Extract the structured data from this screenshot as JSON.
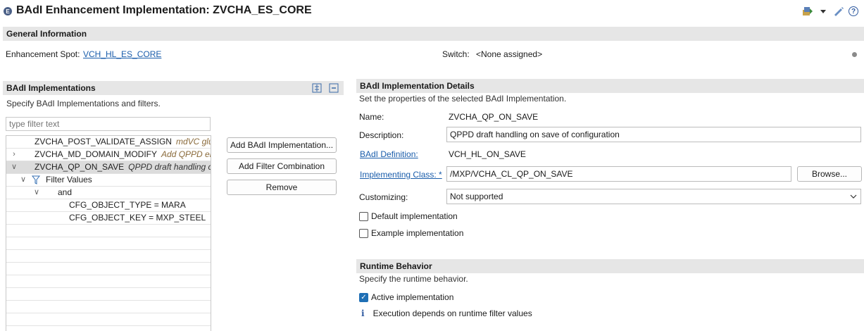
{
  "header": {
    "title": "BAdI Enhancement Implementation: ZVCHA_ES_CORE",
    "title_icon": "E"
  },
  "general": {
    "section_title": "General Information",
    "enh_spot_label": "Enhancement Spot:",
    "enh_spot_value": "VCH_HL_ES_CORE",
    "switch_label": "Switch:",
    "switch_value": "<None assigned>"
  },
  "implementations": {
    "section_title": "BAdI Implementations",
    "subtitle": "Specify BAdI Implementations and filters.",
    "filter_placeholder": "type filter text",
    "rows": [
      {
        "name": "ZVCHA_POST_VALIDATE_ASSIGN",
        "desc": "mdVC glue",
        "twisty": ""
      },
      {
        "name": "ZVCHA_MD_DOMAIN_MODIFY",
        "desc": "Add QPPD ele",
        "twisty": ">"
      },
      {
        "name": "ZVCHA_QP_ON_SAVE",
        "desc": "QPPD draft handling on",
        "twisty": "v"
      },
      {
        "name": "Filter Values",
        "desc": "",
        "twisty": "v"
      },
      {
        "name": "and",
        "desc": "",
        "twisty": "v"
      },
      {
        "name": "CFG_OBJECT_TYPE = MARA",
        "desc": "",
        "twisty": ""
      },
      {
        "name": "CFG_OBJECT_KEY = MXP_STEEL",
        "desc": "",
        "twisty": ""
      }
    ],
    "buttons": {
      "add_impl": "Add BAdI Implementation...",
      "add_filter": "Add Filter Combination",
      "remove": "Remove"
    }
  },
  "details": {
    "section_title": "BAdI Implementation Details",
    "subtitle": "Set the properties of the selected BAdI Implementation.",
    "name_label": "Name:",
    "name_value": "ZVCHA_QP_ON_SAVE",
    "desc_label": "Description:",
    "desc_value": "QPPD draft handling on save of configuration",
    "badi_def_label": "BAdI Definition:",
    "badi_def_value": "VCH_HL_ON_SAVE",
    "impl_class_label": "Implementing Class: *",
    "impl_class_value": "/MXP/VCHA_CL_QP_ON_SAVE",
    "browse_label": "Browse...",
    "customizing_label": "Customizing:",
    "customizing_value": "Not supported",
    "default_impl_label": "Default implementation",
    "default_impl_checked": false,
    "example_impl_label": "Example implementation",
    "example_impl_checked": false
  },
  "runtime": {
    "section_title": "Runtime Behavior",
    "subtitle": "Specify the runtime behavior.",
    "active_label": "Active implementation",
    "active_checked": true,
    "info_text": "Execution depends on runtime filter values"
  },
  "icons": {
    "title": "enhancement-icon",
    "toolbar_1": "deploy-icon",
    "toolbar_2": "dropdown-icon",
    "toolbar_3": "edit-icon",
    "help": "help-icon",
    "expand_all": "expand-all-icon",
    "collapse_all": "collapse-all-icon",
    "filter": "filter-icon",
    "info": "info-icon"
  },
  "colors": {
    "link": "#1a5dab",
    "section_bg": "#e6e6e6",
    "checkbox_on": "#1f6fb5"
  }
}
